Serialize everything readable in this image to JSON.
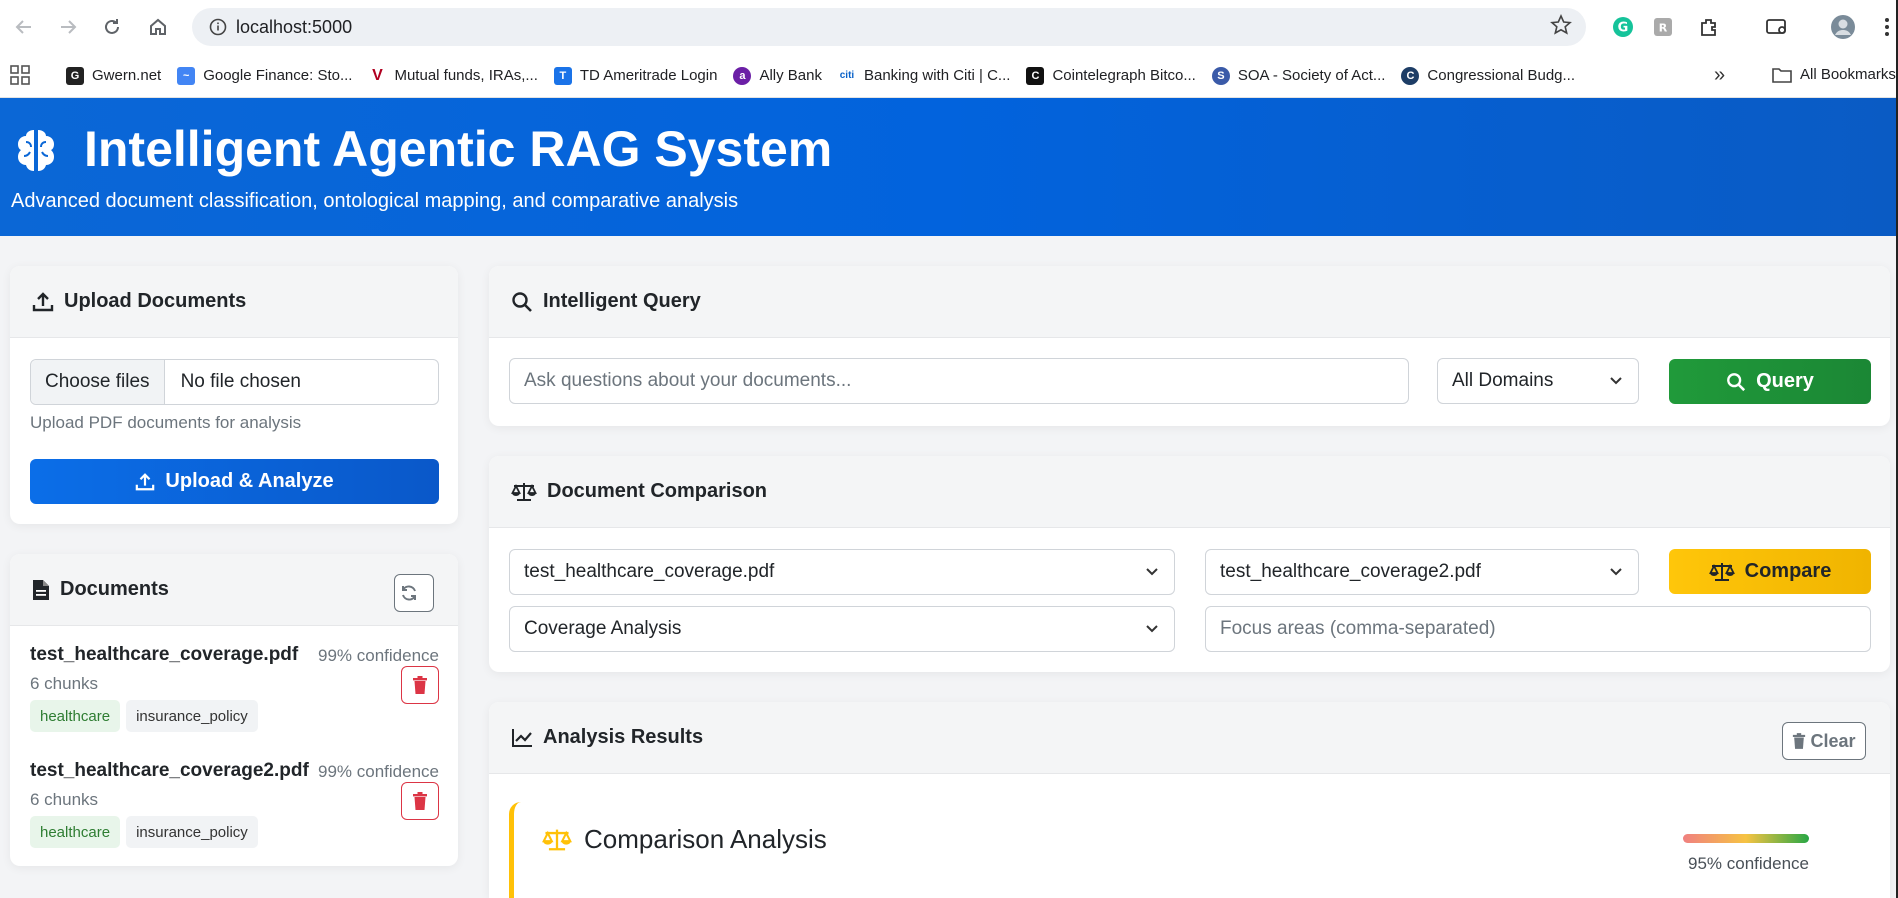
{
  "browser": {
    "url": "localhost:5000",
    "bookmarks": [
      {
        "label": "Gwern.net",
        "icon": "gwern-icon",
        "color": "#222222"
      },
      {
        "label": "Google Finance: Sto...",
        "icon": "google-finance-icon",
        "color": "#4285f4"
      },
      {
        "label": "Mutual funds, IRAs,...",
        "icon": "vanguard-icon",
        "color": "#b00020"
      },
      {
        "label": "TD Ameritrade Login",
        "icon": "td-ameritrade-icon",
        "color": "#1a73e8"
      },
      {
        "label": "Ally Bank",
        "icon": "ally-icon",
        "color": "#6b1fa6"
      },
      {
        "label": "Banking with Citi | C...",
        "icon": "citi-icon",
        "color": "#0a62c9"
      },
      {
        "label": "Cointelegraph Bitco...",
        "icon": "cointelegraph-icon",
        "color": "#111111"
      },
      {
        "label": "SOA - Society of Act...",
        "icon": "soa-icon",
        "color": "#3a5aa8"
      },
      {
        "label": "Congressional Budg...",
        "icon": "cbo-icon",
        "color": "#1d3d66"
      }
    ],
    "more_bookmarks": "»",
    "all_bookmarks": "All Bookmarks"
  },
  "header": {
    "title": "Intelligent Agentic RAG System",
    "subtitle": "Advanced document classification, ontological mapping, and comparative analysis"
  },
  "upload": {
    "title": "Upload Documents",
    "choose_files": "Choose files",
    "no_file": "No file chosen",
    "help": "Upload PDF documents for analysis",
    "button": "Upload & Analyze"
  },
  "documents": {
    "title": "Documents",
    "items": [
      {
        "name": "test_healthcare_coverage.pdf",
        "confidence": "99% confidence",
        "chunks": "6 chunks",
        "domain": "healthcare",
        "type": "insurance_policy"
      },
      {
        "name": "test_healthcare_coverage2.pdf",
        "confidence": "99% confidence",
        "chunks": "6 chunks",
        "domain": "healthcare",
        "type": "insurance_policy"
      }
    ]
  },
  "query": {
    "title": "Intelligent Query",
    "placeholder": "Ask questions about your documents...",
    "domain_selected": "All Domains",
    "button": "Query"
  },
  "comparison": {
    "title": "Document Comparison",
    "doc1": "test_healthcare_coverage.pdf",
    "doc2": "test_healthcare_coverage2.pdf",
    "analysis_type": "Coverage Analysis",
    "focus_placeholder": "Focus areas (comma-separated)",
    "button": "Compare"
  },
  "results": {
    "title": "Analysis Results",
    "clear": "Clear",
    "card_title": "Comparison Analysis",
    "confidence": "95% confidence"
  },
  "colors": {
    "header_blue": "#0263dd",
    "query_green": "#209a3a",
    "compare_yellow": "#ffc60a",
    "delete_red": "#dc3545"
  }
}
